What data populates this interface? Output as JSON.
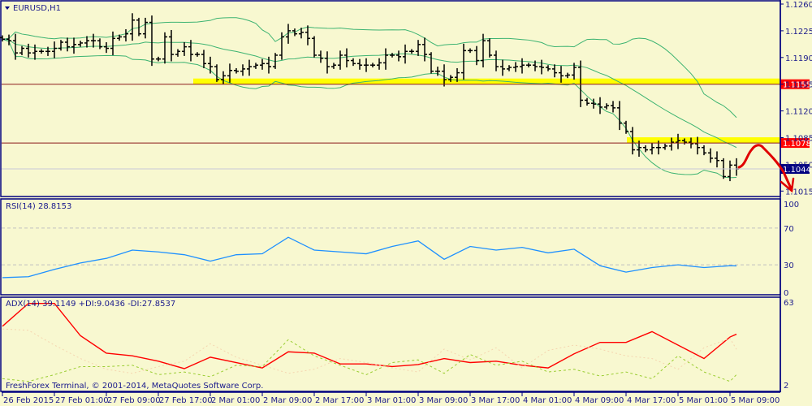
{
  "chart_data": [
    {
      "type": "ohlc",
      "title": "EURUSD,H1",
      "symbol": "EURUSD",
      "timeframe": "H1",
      "ylim": [
        1.1,
        1.1265
      ],
      "y_ticks": [
        "1.1260",
        "1.1225",
        "1.1190",
        "1.1155",
        "1.1120",
        "1.1085",
        "1.1050",
        "1.1015"
      ],
      "x_ticks": [
        "26 Feb 2015",
        "27 Feb 01:00",
        "27 Feb 09:00",
        "27 Feb 17:00",
        "2 Mar 01:00",
        "2 Mar 09:00",
        "2 Mar 17:00",
        "3 Mar 01:00",
        "3 Mar 09:00",
        "3 Mar 17:00",
        "4 Mar 01:00",
        "4 Mar 09:00",
        "4 Mar 17:00",
        "5 Mar 01:00",
        "5 Mar 09:00"
      ],
      "close": [
        1.1214,
        1.1212,
        1.1196,
        1.1202,
        1.1196,
        1.1198,
        1.1198,
        1.1198,
        1.1202,
        1.121,
        1.1204,
        1.1207,
        1.1209,
        1.1212,
        1.1212,
        1.1204,
        1.1202,
        1.1215,
        1.1217,
        1.1221,
        1.1239,
        1.1221,
        1.1236,
        1.1188,
        1.1188,
        1.1217,
        1.1194,
        1.1198,
        1.1204,
        1.1194,
        1.1194,
        1.1182,
        1.1178,
        1.1161,
        1.1166,
        1.1173,
        1.1172,
        1.1175,
        1.1178,
        1.118,
        1.1182,
        1.1178,
        1.1193,
        1.1217,
        1.1225,
        1.1221,
        1.1223,
        1.1215,
        1.1193,
        1.1189,
        1.1178,
        1.118,
        1.1193,
        1.1186,
        1.1182,
        1.118,
        1.118,
        1.118,
        1.1183,
        1.1193,
        1.1193,
        1.1191,
        1.1198,
        1.1198,
        1.1207,
        1.1194,
        1.1172,
        1.1172,
        1.1161,
        1.1164,
        1.117,
        1.1199,
        1.1199,
        1.1186,
        1.1212,
        1.1193,
        1.1178,
        1.1175,
        1.1177,
        1.1178,
        1.118,
        1.118,
        1.1178,
        1.1177,
        1.1175,
        1.117,
        1.1166,
        1.1167,
        1.1177,
        1.1134,
        1.113,
        1.1129,
        1.1125,
        1.1127,
        1.1124,
        1.1104,
        1.1093,
        1.1069,
        1.1072,
        1.1069,
        1.1072,
        1.1072,
        1.1074,
        1.1079,
        1.1081,
        1.1079,
        1.1077,
        1.1072,
        1.1065,
        1.1058,
        1.1055,
        1.1034,
        1.1049,
        1.1044
      ],
      "indicators": "Bollinger Bands (20, 2)",
      "levels": [
        {
          "label": "1.1155",
          "value": 1.1155,
          "color": "#ff0000",
          "highlight": "#ffff00"
        },
        {
          "label": "1.1078",
          "value": 1.1078,
          "color": "#ff0000",
          "highlight": "#ffff00"
        }
      ],
      "current_price": {
        "label": "1.1044",
        "value": 1.1044,
        "color": "#000080"
      },
      "annotation": "red hand-drawn arrow: up to resistance 1.1078 then down below 1.1015"
    },
    {
      "type": "line",
      "title": "RSI(14) 28.8153",
      "ylim": [
        0,
        100
      ],
      "y_ticks": [
        "100",
        "70",
        "30",
        "0"
      ],
      "levels": [
        70,
        30
      ],
      "sample_every_bars": 4,
      "values": [
        16,
        17,
        25,
        32,
        37,
        46,
        44,
        41,
        34,
        41,
        42,
        60,
        46,
        44,
        42,
        50,
        56,
        36,
        50,
        46,
        49,
        43,
        47,
        29,
        22,
        27,
        30,
        27,
        29,
        28.8
      ]
    },
    {
      "type": "line",
      "title": "ADX(14) 39.1149 +DI:9.0436 -DI:27.8537",
      "ylim": [
        2,
        63
      ],
      "y_ticks": [
        "63",
        "2"
      ],
      "sample_every_bars": 4,
      "series": [
        {
          "name": "ADX",
          "color": "#ff0000",
          "values": [
            45,
            62,
            62,
            38,
            25,
            23,
            19,
            13.5,
            22,
            18,
            14,
            26,
            25,
            17,
            17,
            15,
            16.5,
            21,
            18,
            19,
            16,
            14,
            24.5,
            33,
            33,
            41,
            31,
            21,
            37,
            39.1
          ]
        },
        {
          "name": "+DI",
          "color": "#9acd32",
          "values": [
            6,
            4,
            9,
            15,
            15,
            16,
            9,
            11,
            7.5,
            16,
            15,
            35,
            23,
            16,
            9,
            18,
            20,
            10,
            24,
            16,
            19,
            11,
            13,
            8,
            11,
            6,
            23,
            11,
            4,
            9.04
          ]
        },
        {
          "name": "-DI",
          "color": "#f5d5b0",
          "values": [
            43,
            42,
            31,
            21,
            13,
            10,
            15,
            19,
            32,
            22,
            16,
            10,
            13,
            21,
            18,
            14,
            11,
            28,
            20,
            29,
            14,
            27,
            31,
            28,
            23,
            21,
            13,
            29,
            36,
            27.85
          ]
        }
      ]
    }
  ],
  "footer": {
    "copyright": "FreshForex Terminal, © 2001-2014, MetaQuotes Software Corp."
  }
}
